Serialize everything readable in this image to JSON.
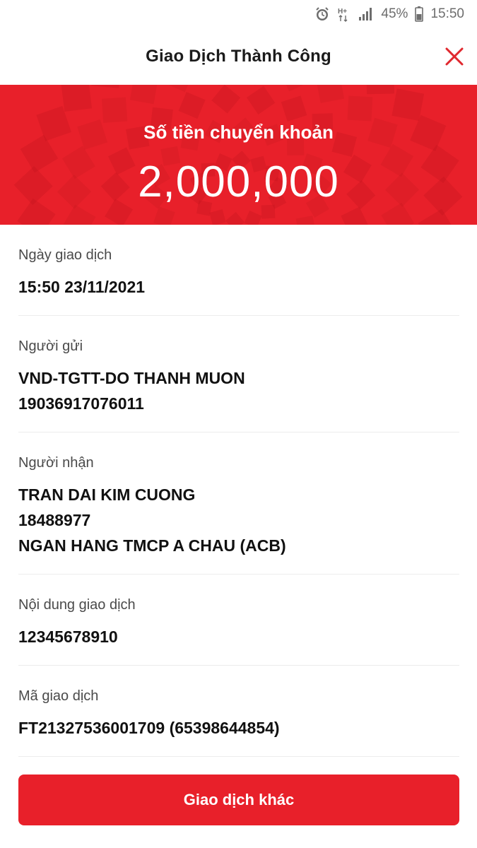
{
  "status_bar": {
    "network": "H+",
    "battery_percent": "45%",
    "time": "15:50",
    "icons": [
      "alarm-icon",
      "network-icon",
      "signal-icon",
      "battery-icon"
    ]
  },
  "header": {
    "title": "Giao Dịch Thành Công",
    "close_icon": "close-icon"
  },
  "banner": {
    "label": "Số tiền chuyển khoản",
    "amount": "2,000,000"
  },
  "details": {
    "date": {
      "label": "Ngày giao dịch",
      "value": "15:50 23/11/2021"
    },
    "sender": {
      "label": "Người gửi",
      "name": "VND-TGTT-DO THANH MUON",
      "account": "19036917076011"
    },
    "receiver": {
      "label": "Người nhận",
      "name": "TRAN DAI KIM CUONG",
      "account": "18488977",
      "bank": "NGAN HANG TMCP A CHAU (ACB)"
    },
    "content": {
      "label": "Nội dung giao dịch",
      "value": "12345678910"
    },
    "code": {
      "label": "Mã giao dịch",
      "value": "FT21327536001709 (65398644854)"
    }
  },
  "action_button": {
    "label": "Giao dịch khác"
  },
  "colors": {
    "accent": "#e8202a",
    "text": "#111111",
    "muted": "#4a4a4a"
  }
}
